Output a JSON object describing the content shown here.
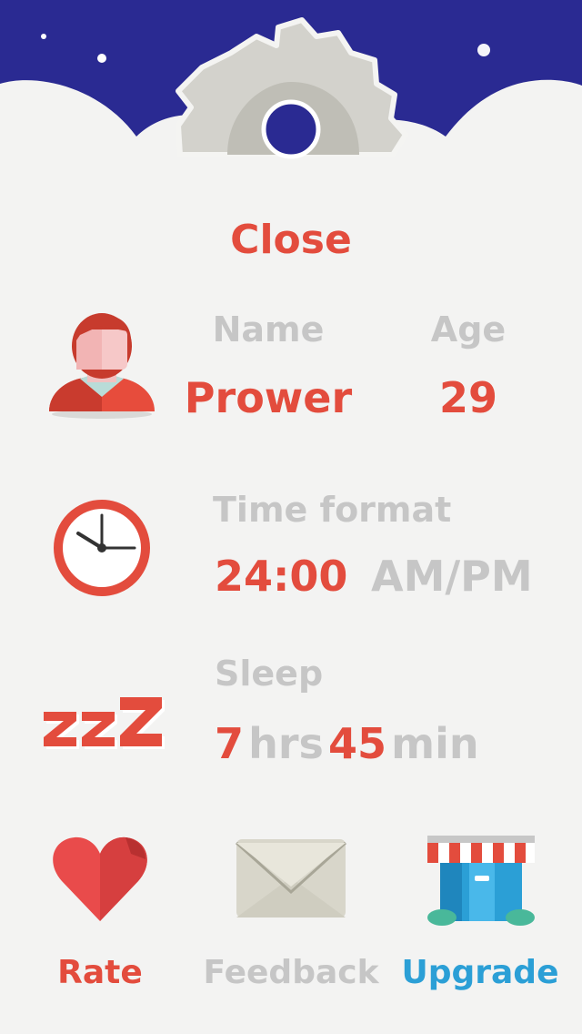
{
  "colors": {
    "accent_red": "#e34c3d",
    "muted_gray": "#c6c6c6",
    "upgrade_blue": "#2b9fd6",
    "night_sky": "#2a2a92",
    "cloud": "#f3f3f2"
  },
  "header": {
    "icon": "gear-icon"
  },
  "close_label": "Close",
  "profile": {
    "icon": "person-avatar-icon",
    "name_label": "Name",
    "name_value": "Prower",
    "age_label": "Age",
    "age_value": "29"
  },
  "time_format": {
    "icon": "clock-icon",
    "label": "Time format",
    "option_24h": "24:00",
    "option_ampm": "AM/PM",
    "selected": "24:00"
  },
  "sleep": {
    "icon": "zzz-icon",
    "label": "Sleep",
    "hours_value": "7",
    "hours_unit": "hrs",
    "minutes_value": "45",
    "minutes_unit": "min"
  },
  "bottom_actions": {
    "rate": {
      "label": "Rate",
      "icon": "heart-icon"
    },
    "feedback": {
      "label": "Feedback",
      "icon": "envelope-icon"
    },
    "upgrade": {
      "label": "Upgrade",
      "icon": "store-icon"
    }
  }
}
